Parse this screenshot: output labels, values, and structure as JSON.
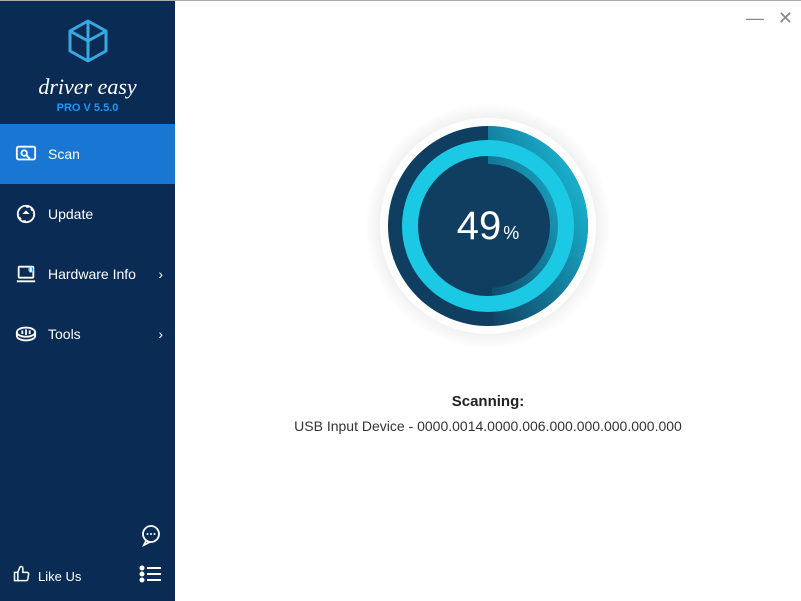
{
  "brand": {
    "name": "driver easy",
    "version": "PRO V 5.5.0"
  },
  "nav": {
    "scan": "Scan",
    "update": "Update",
    "hardware": "Hardware Info",
    "tools": "Tools",
    "like": "Like Us"
  },
  "progress": {
    "value": "49",
    "unit": "%"
  },
  "scan": {
    "label": "Scanning:",
    "detail": "USB Input Device - 0000.0014.0000.006.000.000.000.000.000"
  },
  "colors": {
    "sidebar": "#0a2c54",
    "active": "#1976d2",
    "accent": "#2196f3",
    "ring_dark": "#0f3e60",
    "ring_light": "#1bc9e4"
  }
}
